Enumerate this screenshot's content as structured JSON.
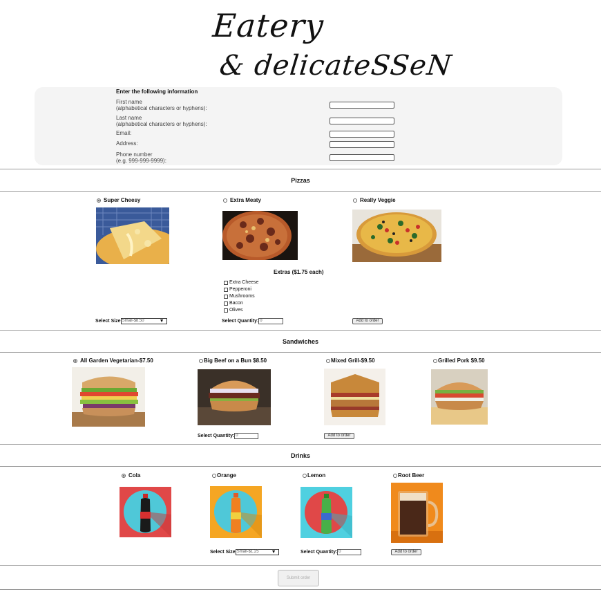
{
  "logo": {
    "line1": "Eatery",
    "line2": "& delicateSSeN"
  },
  "info_form": {
    "title": "Enter the following information",
    "fields": [
      {
        "label_line1": "First name",
        "label_line2": "(alphabetical characters or hyphens):",
        "value": ""
      },
      {
        "label_line1": "Last name",
        "label_line2": "(alphabetical characters or hyphens):",
        "value": ""
      },
      {
        "label_line1": "Email:",
        "label_line2": "",
        "value": ""
      },
      {
        "label_line1": "Address:",
        "label_line2": "",
        "value": ""
      },
      {
        "label_line1": "Phone number",
        "label_line2": "(e.g. 999-999-9999):",
        "value": ""
      }
    ]
  },
  "pizzas": {
    "title": "Pizzas",
    "options": [
      {
        "label": "Super Cheesy",
        "selected": true
      },
      {
        "label": "Extra Meaty",
        "selected": false
      },
      {
        "label": "Really Veggie",
        "selected": false
      }
    ],
    "extras_title": "Extras ($1.75 each)",
    "extras": [
      "Extra Cheese",
      "Pepperoni",
      "Mushrooms",
      "Bacon",
      "Olives"
    ],
    "size_label": "Select Size",
    "size_value": "Small-$8.50",
    "quantity_label": "Select Quantity:",
    "quantity_value": "0",
    "add_label": "Add to order"
  },
  "sandwiches": {
    "title": "Sandwiches",
    "options": [
      {
        "label": "All Garden Vegetarian-$7.50",
        "selected": true
      },
      {
        "label": "Big Beef on a Bun $8.50",
        "selected": false
      },
      {
        "label": "Mixed Grill-$9.50",
        "selected": false
      },
      {
        "label": "Grilled Pork $9.50",
        "selected": false
      }
    ],
    "quantity_label": "Select Quantity:",
    "quantity_value": "0",
    "add_label": "Add to order"
  },
  "drinks": {
    "title": "Drinks",
    "options": [
      {
        "label": "Cola",
        "selected": true
      },
      {
        "label": "Orange",
        "selected": false
      },
      {
        "label": "Lemon",
        "selected": false
      },
      {
        "label": "Root Beer",
        "selected": false
      }
    ],
    "size_label": "Select Size",
    "size_value": "Small-$1.25",
    "quantity_label": "Select Quantity:",
    "quantity_value": "0",
    "add_label": "Add to order"
  },
  "submit_label": "Submit order",
  "colors": {
    "panel_bg": "#f4f4f4",
    "rule": "#999999",
    "cola_bg": "#e04848",
    "cola_circle": "#4fc8d8",
    "orange_bg": "#f5a623",
    "orange_circle": "#4fc8d8",
    "lemon_bg": "#4fd0e0",
    "lemon_circle": "#e04848",
    "rootbeer_bg": "#f08a1c"
  }
}
